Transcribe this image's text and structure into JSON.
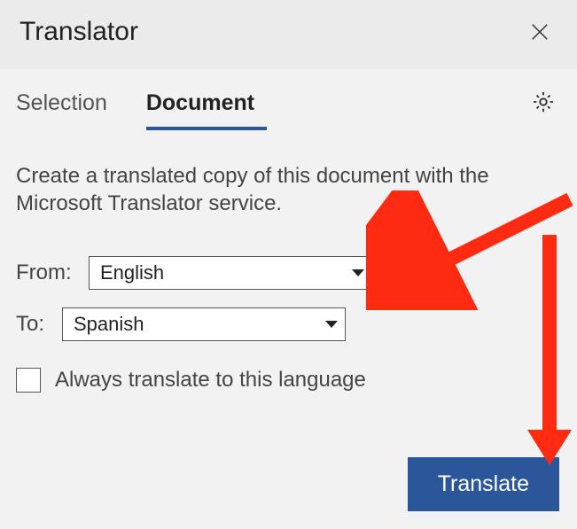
{
  "header": {
    "title": "Translator"
  },
  "tabs": {
    "selection": "Selection",
    "document": "Document",
    "active": "document"
  },
  "description": "Create a translated copy of this document with the Microsoft Translator service.",
  "fields": {
    "from_label": "From:",
    "from_value": "English",
    "to_label": "To:",
    "to_value": "Spanish"
  },
  "checkbox": {
    "label": "Always translate to this language",
    "checked": false
  },
  "buttons": {
    "translate": "Translate"
  }
}
